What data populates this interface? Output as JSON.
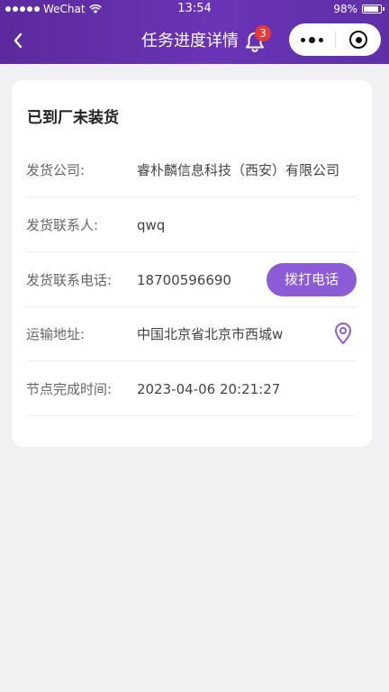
{
  "status_bar": {
    "carrier": "WeChat",
    "time": "13:54",
    "battery": "98%"
  },
  "header": {
    "title": "任务进度详情",
    "notification_count": "3",
    "icons": {
      "back": "chevron-left-icon",
      "bell": "bell-icon",
      "more": "more-dots-icon",
      "close": "target-close-icon"
    }
  },
  "card": {
    "title": "已到厂未装货",
    "rows": [
      {
        "label": "发货公司:",
        "value": "睿朴麟信息科技（西安）有限公司"
      },
      {
        "label": "发货联系人:",
        "value": "qwq"
      },
      {
        "label": "发货联系电话:",
        "value": "18700596690"
      },
      {
        "label": "运输地址:",
        "value": "中国北京省北京市西城w"
      },
      {
        "label": "节点完成时间:",
        "value": "2023-04-06 20:21:27"
      }
    ],
    "call_button_label": "拨打电话",
    "location_icon": "map-pin-icon"
  },
  "colors": {
    "header_bg": "#5f2fa8",
    "accent": "#8c5bd6",
    "badge": "#e53935",
    "page_bg": "#f1f0f3"
  }
}
